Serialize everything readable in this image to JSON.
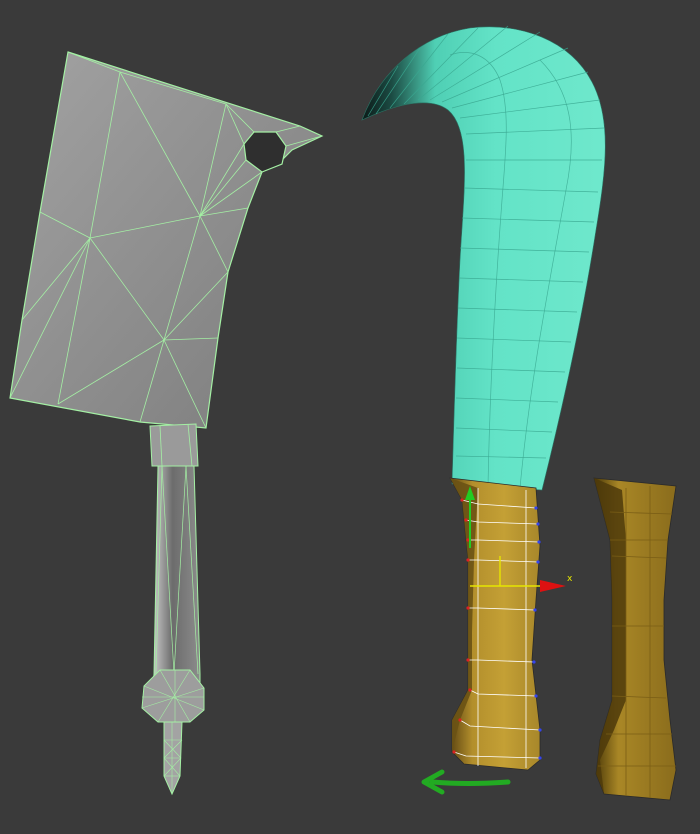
{
  "viewport": {
    "background": "#3a3a3a",
    "gizmo": {
      "x_axis_label": "x"
    }
  },
  "colors": {
    "cleaver_fill": "#8d8d8d",
    "cleaver_wire": "#a4f0a4",
    "blade_fill": "#5fe0c4",
    "blade_dark": "#0f2420",
    "handle_fill": "#c09a30",
    "handle_dark": "#5a4410",
    "gizmo_y": "#22cc22",
    "gizmo_x": "#dd1111",
    "gizmo_axis_yellow": "#e6e600",
    "arrow": "#22aa22"
  }
}
